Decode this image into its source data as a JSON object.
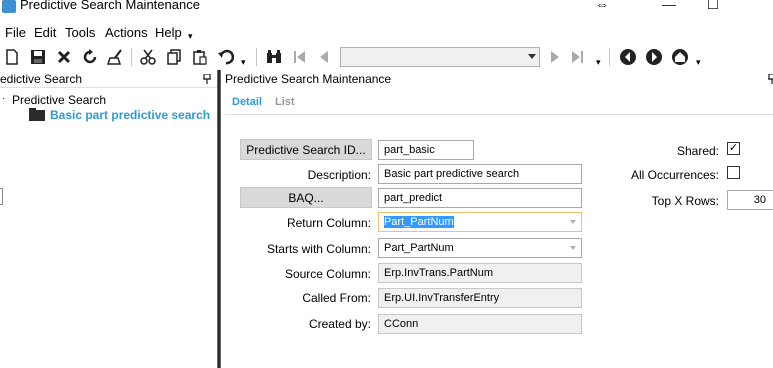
{
  "window": {
    "title": "Predictive Search Maintenance",
    "controls": {
      "restore": "⇔",
      "minimize": "—",
      "maximize": "☐"
    }
  },
  "menu": [
    {
      "label": "File"
    },
    {
      "label": "Edit"
    },
    {
      "label": "Tools"
    },
    {
      "label": "Actions"
    },
    {
      "label": "Help"
    }
  ],
  "toolbar": {
    "icons": [
      "new-icon",
      "save-icon",
      "delete-icon",
      "refresh-icon",
      "clear-icon",
      "cut-icon",
      "copy-icon",
      "paste-icon",
      "undo-icon",
      "search-binoculars-icon",
      "first-record-icon",
      "previous-record-icon",
      "next-record-icon",
      "last-record-icon",
      "back-circle-icon",
      "forward-circle-icon",
      "home-icon"
    ],
    "nav_value": ""
  },
  "left_panel": {
    "header": "edictive Search",
    "tree_root": "Predictive Search",
    "tree_child": "Basic part predictive search"
  },
  "right_panel": {
    "header": "Predictive Search Maintenance",
    "tabs": [
      {
        "label": "Detail",
        "active": true
      },
      {
        "label": "List",
        "active": false
      }
    ]
  },
  "form": {
    "id_button": "Predictive Search ID...",
    "id_value": "part_basic",
    "description_label": "Description:",
    "description_value": "Basic part predictive search",
    "baq_button": "BAQ...",
    "baq_value": "part_predict",
    "return_column_label": "Return Column:",
    "return_column_value": "Part_PartNum",
    "starts_with_label": "Starts with Column:",
    "starts_with_value": "Part_PartNum",
    "source_column_label": "Source Column:",
    "source_column_value": "Erp.InvTrans.PartNum",
    "called_from_label": "Called From:",
    "called_from_value": "Erp.UI.InvTransferEntry",
    "created_by_label": "Created by:",
    "created_by_value": "CConn",
    "shared_label": "Shared:",
    "shared_checked": true,
    "all_occurrences_label": "All Occurrences:",
    "all_occurrences_checked": false,
    "top_x_label": "Top X Rows:",
    "top_x_value": "30"
  }
}
